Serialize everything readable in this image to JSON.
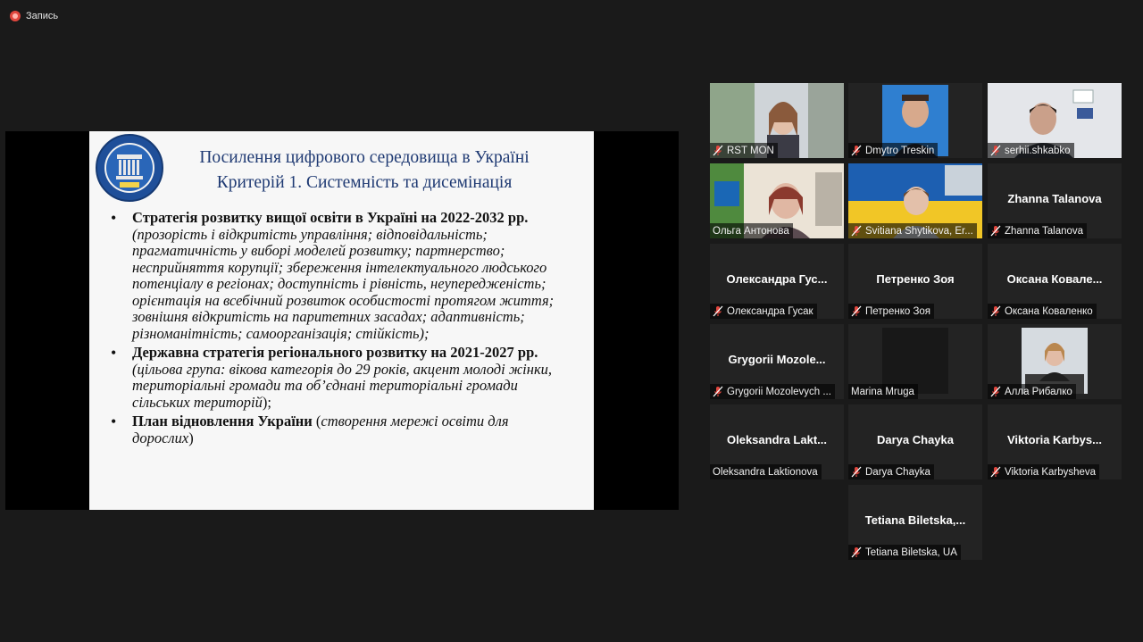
{
  "recording": {
    "label": "Запись",
    "color": "#e0463d"
  },
  "slide": {
    "title_line1": "Посилення цифрового середовища в Україні",
    "title_line2": "Критерій 1. Системність та дисемінація",
    "items": [
      {
        "bold": "Стратегія розвитку вищої освіти в Україні на 2022-2032 рр.",
        "italic": " (прозорість і відкритість управління; відповідальність; прагматичність у виборі моделей розвитку; партнерство; несприйняття корупції; збереження інтелектуального людського потенціалу в регіонах; доступність і рівність, неупередженість; орієнтація на всебічний розвиток особистості протягом життя; зовнішня відкритість на паритетних засадах; адаптивність; різноманітність; самоорганізація; стійкість);",
        "tail": ""
      },
      {
        "bold": "Державна стратегія регіонального розвитку на 2021-2027 рр.",
        "italic": " (цільова група: вікова категорія до 29 років, акцент молоді жінки, територіальні громади та об’єднані територіальні громади сільських територій",
        "tail": ");"
      },
      {
        "bold": "План відновлення України",
        "italic": "",
        "tail": " (",
        "italic2": "створення мережі освіти для дорослих",
        "tail2": ")"
      }
    ]
  },
  "participants": [
    {
      "label": "RST MON",
      "big": "",
      "muted": true,
      "video": "woman1"
    },
    {
      "label": "Dmytro Treskin",
      "big": "",
      "muted": true,
      "video": "man1"
    },
    {
      "label": "serhii.shkabko",
      "big": "",
      "muted": true,
      "video": "man2"
    },
    {
      "label": "Ольга Антонова",
      "big": "",
      "muted": false,
      "video": "woman2",
      "active": true
    },
    {
      "label": "Svitiana Shytikova, Er...",
      "big": "",
      "muted": true,
      "video": "woman3"
    },
    {
      "label": "Zhanna Talanova",
      "big": "Zhanna Talanova",
      "muted": true,
      "video": ""
    },
    {
      "label": "Олександра Гусак",
      "big": "Олександра Гус...",
      "muted": true,
      "video": ""
    },
    {
      "label": "Петренко Зоя",
      "big": "Петренко Зоя",
      "muted": true,
      "video": ""
    },
    {
      "label": "Оксана Коваленко",
      "big": "Оксана Ковале...",
      "muted": true,
      "video": ""
    },
    {
      "label": "Grygorii Mozolevych ...",
      "big": "Grygorii Mozole...",
      "muted": true,
      "video": ""
    },
    {
      "label": "Marina Mruga",
      "big": "",
      "muted": false,
      "video": "dark"
    },
    {
      "label": "Алла Рибалко",
      "big": "",
      "muted": true,
      "video": "woman4"
    },
    {
      "label": "Oleksandra Laktionova",
      "big": "Oleksandra Lakt...",
      "muted": false,
      "video": ""
    },
    {
      "label": "Darya Chayka",
      "big": "Darya Chayka",
      "muted": true,
      "video": ""
    },
    {
      "label": "Viktoria Karbysheva",
      "big": "Viktoria Karbys...",
      "muted": true,
      "video": ""
    },
    {
      "label": "Tetiana Biletska, UA",
      "big": "Tetiana Biletska,...",
      "muted": true,
      "video": ""
    }
  ],
  "colors": {
    "muted_mic": "#e0463d",
    "active_speaker": "#e8d33a",
    "slide_title": "#1f3a73"
  }
}
